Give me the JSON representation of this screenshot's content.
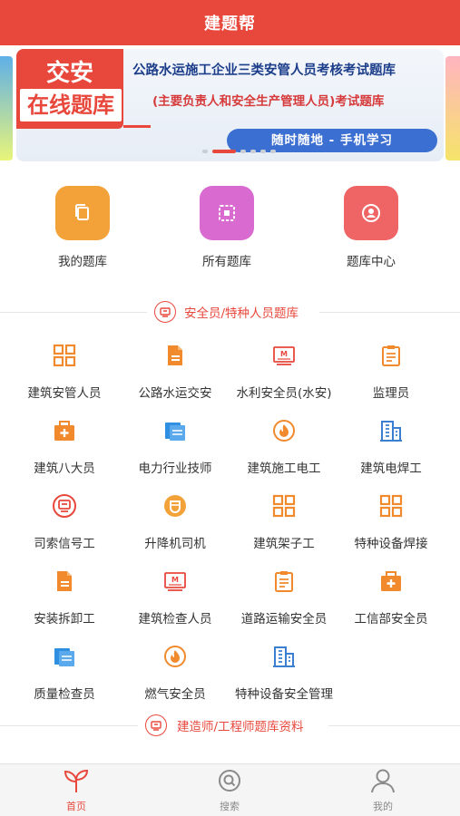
{
  "header": {
    "title": "建题帮"
  },
  "banner": {
    "badge_top": "交安",
    "badge_bottom": "在线题库",
    "title": "公路水运施工企业三类安管人员考核考试题库",
    "subtitle": "(主要负责人和安全生产管理人员)考试题库",
    "pill": "随时随地  - 手机学习",
    "active_dot": 1
  },
  "quick": [
    {
      "label": "我的题库",
      "icon": "copy-icon",
      "color": "#f3a23a"
    },
    {
      "label": "所有题库",
      "icon": "grid-square-icon",
      "color": "#d86ad0"
    },
    {
      "label": "题库中心",
      "icon": "user-circle-icon",
      "color": "#ef6565"
    }
  ],
  "section1": {
    "title": "安全员/特种人员题库",
    "icon": "exam-icon"
  },
  "section2": {
    "title": "建造师/工程师题库资料",
    "icon": "exam-icon"
  },
  "grid_items": [
    {
      "label": "建筑安管人员",
      "icon": "grid-icon"
    },
    {
      "label": "公路水运交安",
      "icon": "document-icon"
    },
    {
      "label": "水利安全员(水安)",
      "icon": "certificate-icon"
    },
    {
      "label": "监理员",
      "icon": "clipboard-icon"
    },
    {
      "label": "建筑八大员",
      "icon": "medical-kit-icon"
    },
    {
      "label": "电力行业技师",
      "icon": "files-icon"
    },
    {
      "label": "建筑施工电工",
      "icon": "fire-icon"
    },
    {
      "label": "建筑电焊工",
      "icon": "building-icon"
    },
    {
      "label": "司索信号工",
      "icon": "exam-icon"
    },
    {
      "label": "升降机司机",
      "icon": "badge-icon"
    },
    {
      "label": "建筑架子工",
      "icon": "grid-icon"
    },
    {
      "label": "特种设备焊接",
      "icon": "grid-icon"
    },
    {
      "label": "安装拆卸工",
      "icon": "document-icon"
    },
    {
      "label": "建筑检查人员",
      "icon": "certificate-icon"
    },
    {
      "label": "道路运输安全员",
      "icon": "clipboard-icon"
    },
    {
      "label": "工信部安全员",
      "icon": "medical-kit-icon"
    },
    {
      "label": "质量检查员",
      "icon": "files-icon"
    },
    {
      "label": "燃气安全员",
      "icon": "fire-icon"
    },
    {
      "label": "特种设备安全管理",
      "icon": "building-icon"
    }
  ],
  "tabbar": [
    {
      "label": "首页",
      "icon": "sprout-icon",
      "active": true
    },
    {
      "label": "搜索",
      "icon": "search-icon",
      "active": false
    },
    {
      "label": "我的",
      "icon": "person-icon",
      "active": false
    }
  ],
  "colors": {
    "primary": "#e8483c",
    "accent_blue": "#3c6fd2",
    "icon_orange": "#f08a2c",
    "icon_blue": "#3a7fd0",
    "icon_gray": "#a0a0a0",
    "icon_red": "#e8483c",
    "tab_inactive": "#8a8a8a"
  }
}
